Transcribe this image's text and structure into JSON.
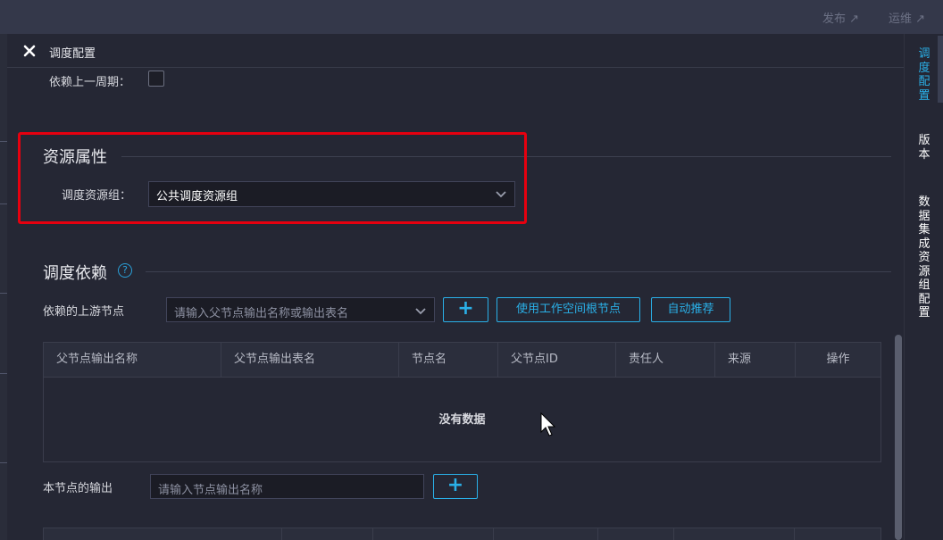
{
  "topbar": {
    "links": [
      {
        "label": "发布 ↗"
      },
      {
        "label": "运维 ↗"
      }
    ]
  },
  "panel": {
    "title": "调度配置",
    "depends_prev_cycle_label": "依赖上一周期："
  },
  "resource_section": {
    "title": "资源属性",
    "group_label": "调度资源组：",
    "group_value": "公共调度资源组"
  },
  "dependency_section": {
    "title": "调度依赖",
    "upstream_label": "依赖的上游节点",
    "upstream_placeholder": "请输入父节点输出名称或输出表名",
    "add_button": "+",
    "use_root_button": "使用工作空间根节点",
    "auto_recommend_button": "自动推荐",
    "table": {
      "columns": [
        "父节点输出名称",
        "父节点输出表名",
        "节点名",
        "父节点ID",
        "责任人",
        "来源",
        "操作"
      ],
      "empty_text": "没有数据"
    },
    "output_label": "本节点的输出",
    "output_placeholder": "请输入节点输出名称",
    "output_add_button": "+"
  },
  "right_sidebar": {
    "items": [
      {
        "label": "调\n度\n配\n置",
        "active": true
      },
      {
        "label": "版\n本",
        "active": false
      },
      {
        "label": "数\n据\n集\n成\n资\n源\n组\n配\n置",
        "active": false
      }
    ]
  },
  "colors": {
    "accent": "#2ab0e8",
    "highlight_box": "#e6000f",
    "background": "#252734"
  }
}
